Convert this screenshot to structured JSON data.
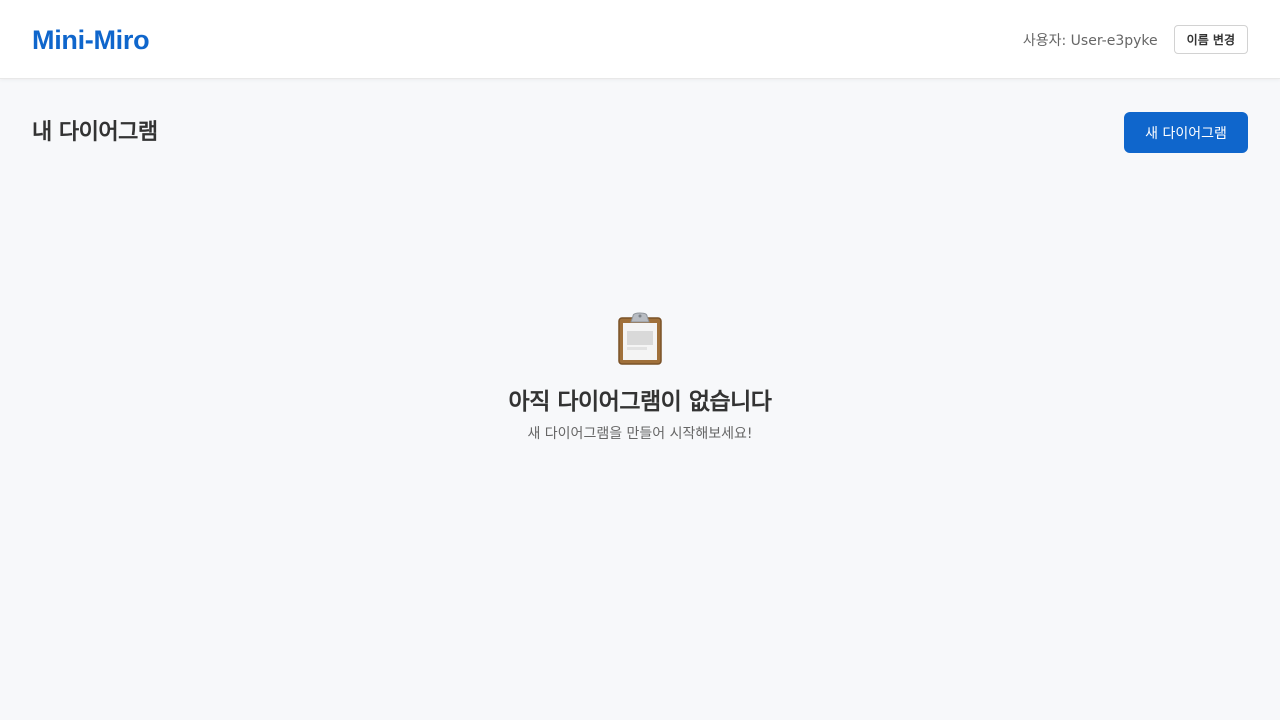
{
  "header": {
    "logo": "Mini-Miro",
    "user_label": "사용자: User-e3pyke",
    "rename_button": "이름 변경"
  },
  "main": {
    "title": "내 다이어그램",
    "new_diagram_button": "새 다이어그램",
    "empty_state": {
      "icon": "clipboard-icon",
      "title": "아직 다이어그램이 없습니다",
      "subtitle": "새 다이어그램을 만들어 시작해보세요!"
    }
  },
  "colors": {
    "accent": "#0f66cc",
    "background": "#f7f8fa",
    "header_background": "#ffffff",
    "text": "#333333",
    "muted_text": "#666666"
  }
}
